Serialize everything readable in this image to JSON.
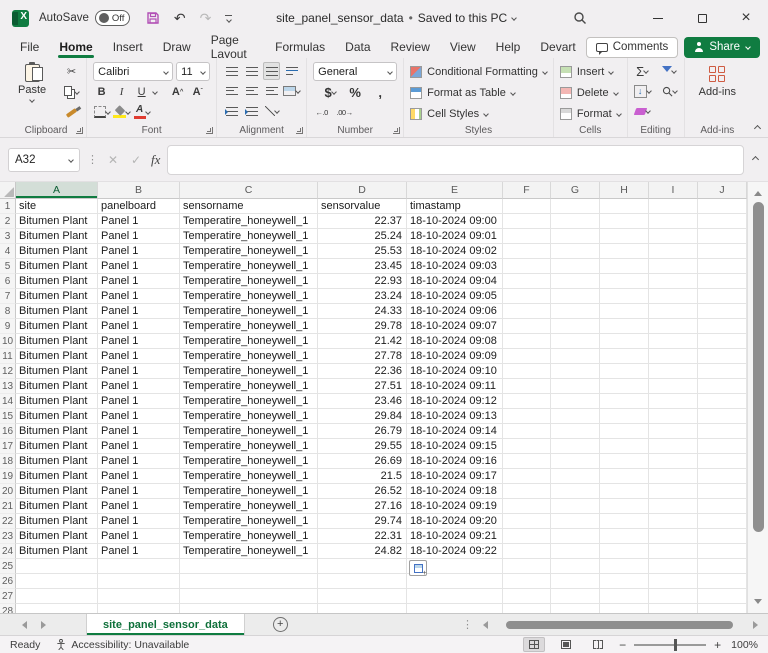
{
  "titlebar": {
    "autosave_label": "AutoSave",
    "autosave_state": "Off",
    "doc_title": "site_panel_sensor_data",
    "separator": "•",
    "saved_status": "Saved to this PC"
  },
  "menu": {
    "tabs": [
      "File",
      "Home",
      "Insert",
      "Draw",
      "Page Layout",
      "Formulas",
      "Data",
      "Review",
      "View",
      "Help",
      "Devart"
    ],
    "active_tab": "Home",
    "comments_label": "Comments",
    "share_label": "Share"
  },
  "ribbon": {
    "clipboard": {
      "group_label": "Clipboard",
      "paste_label": "Paste"
    },
    "font": {
      "group_label": "Font",
      "font_name": "Calibri",
      "font_size": "11",
      "bold": "B",
      "italic": "I",
      "underline": "U",
      "grow_letter": "A",
      "shrink_letter": "A",
      "font_color_letter": "A"
    },
    "alignment": {
      "group_label": "Alignment"
    },
    "number": {
      "group_label": "Number",
      "format": "General",
      "currency": "$",
      "percent": "%",
      "comma": ",",
      "increase_decimal": "←.0",
      "decrease_decimal": ".00→"
    },
    "styles": {
      "group_label": "Styles",
      "items": [
        "Conditional Formatting",
        "Format as Table",
        "Cell Styles"
      ]
    },
    "cells": {
      "group_label": "Cells",
      "items": [
        "Insert",
        "Delete",
        "Format"
      ]
    },
    "editing": {
      "group_label": "Editing",
      "autosum_glyph": "Σ",
      "fill_glyph": "↓"
    },
    "addins": {
      "group_label": "Add-ins",
      "button_label": "Add-ins"
    }
  },
  "glyphs": {
    "undo": "↶",
    "redo": "↷",
    "cut": "✂",
    "close": "×",
    "new_sheet": "+",
    "zoom_out": "−",
    "zoom_in": "+",
    "vdots": "⋮"
  },
  "formula_bar": {
    "name_box": "A32",
    "cancel": "✕",
    "enter": "✓",
    "fx_label": "fx",
    "formula_value": ""
  },
  "grid": {
    "columns": [
      "A",
      "B",
      "C",
      "D",
      "E",
      "F",
      "G",
      "H",
      "I",
      "J"
    ],
    "selected_column": "A",
    "selected_cell": "A32",
    "visible_rows": 27,
    "header_row": [
      "site",
      "panelboard",
      "sensorname",
      "sensorvalue",
      "timastamp"
    ],
    "data_rows": [
      [
        "Bitumen Plant",
        "Panel 1",
        "Temperatire_honeywell_1",
        "22.37",
        "18-10-2024 09:00"
      ],
      [
        "Bitumen Plant",
        "Panel 1",
        "Temperatire_honeywell_1",
        "25.24",
        "18-10-2024 09:01"
      ],
      [
        "Bitumen Plant",
        "Panel 1",
        "Temperatire_honeywell_1",
        "25.53",
        "18-10-2024 09:02"
      ],
      [
        "Bitumen Plant",
        "Panel 1",
        "Temperatire_honeywell_1",
        "23.45",
        "18-10-2024 09:03"
      ],
      [
        "Bitumen Plant",
        "Panel 1",
        "Temperatire_honeywell_1",
        "22.93",
        "18-10-2024 09:04"
      ],
      [
        "Bitumen Plant",
        "Panel 1",
        "Temperatire_honeywell_1",
        "23.24",
        "18-10-2024 09:05"
      ],
      [
        "Bitumen Plant",
        "Panel 1",
        "Temperatire_honeywell_1",
        "24.33",
        "18-10-2024 09:06"
      ],
      [
        "Bitumen Plant",
        "Panel 1",
        "Temperatire_honeywell_1",
        "29.78",
        "18-10-2024 09:07"
      ],
      [
        "Bitumen Plant",
        "Panel 1",
        "Temperatire_honeywell_1",
        "21.42",
        "18-10-2024 09:08"
      ],
      [
        "Bitumen Plant",
        "Panel 1",
        "Temperatire_honeywell_1",
        "27.78",
        "18-10-2024 09:09"
      ],
      [
        "Bitumen Plant",
        "Panel 1",
        "Temperatire_honeywell_1",
        "22.36",
        "18-10-2024 09:10"
      ],
      [
        "Bitumen Plant",
        "Panel 1",
        "Temperatire_honeywell_1",
        "27.51",
        "18-10-2024 09:11"
      ],
      [
        "Bitumen Plant",
        "Panel 1",
        "Temperatire_honeywell_1",
        "23.46",
        "18-10-2024 09:12"
      ],
      [
        "Bitumen Plant",
        "Panel 1",
        "Temperatire_honeywell_1",
        "29.84",
        "18-10-2024 09:13"
      ],
      [
        "Bitumen Plant",
        "Panel 1",
        "Temperatire_honeywell_1",
        "26.79",
        "18-10-2024 09:14"
      ],
      [
        "Bitumen Plant",
        "Panel 1",
        "Temperatire_honeywell_1",
        "29.55",
        "18-10-2024 09:15"
      ],
      [
        "Bitumen Plant",
        "Panel 1",
        "Temperatire_honeywell_1",
        "26.69",
        "18-10-2024 09:16"
      ],
      [
        "Bitumen Plant",
        "Panel 1",
        "Temperatire_honeywell_1",
        "21.5",
        "18-10-2024 09:17"
      ],
      [
        "Bitumen Plant",
        "Panel 1",
        "Temperatire_honeywell_1",
        "26.52",
        "18-10-2024 09:18"
      ],
      [
        "Bitumen Plant",
        "Panel 1",
        "Temperatire_honeywell_1",
        "27.16",
        "18-10-2024 09:19"
      ],
      [
        "Bitumen Plant",
        "Panel 1",
        "Temperatire_honeywell_1",
        "29.74",
        "18-10-2024 09:20"
      ],
      [
        "Bitumen Plant",
        "Panel 1",
        "Temperatire_honeywell_1",
        "22.31",
        "18-10-2024 09:21"
      ],
      [
        "Bitumen Plant",
        "Panel 1",
        "Temperatire_honeywell_1",
        "24.82",
        "18-10-2024 09:22"
      ]
    ]
  },
  "sheet_bar": {
    "active_tab": "site_panel_sensor_data"
  },
  "status_bar": {
    "mode": "Ready",
    "accessibility": "Accessibility: Unavailable",
    "zoom_level": "100%"
  },
  "colors": {
    "accent_green": "#107C41",
    "save_icon_purple": "#B14EB5",
    "addins_icon_orange": "#CF5B42"
  }
}
